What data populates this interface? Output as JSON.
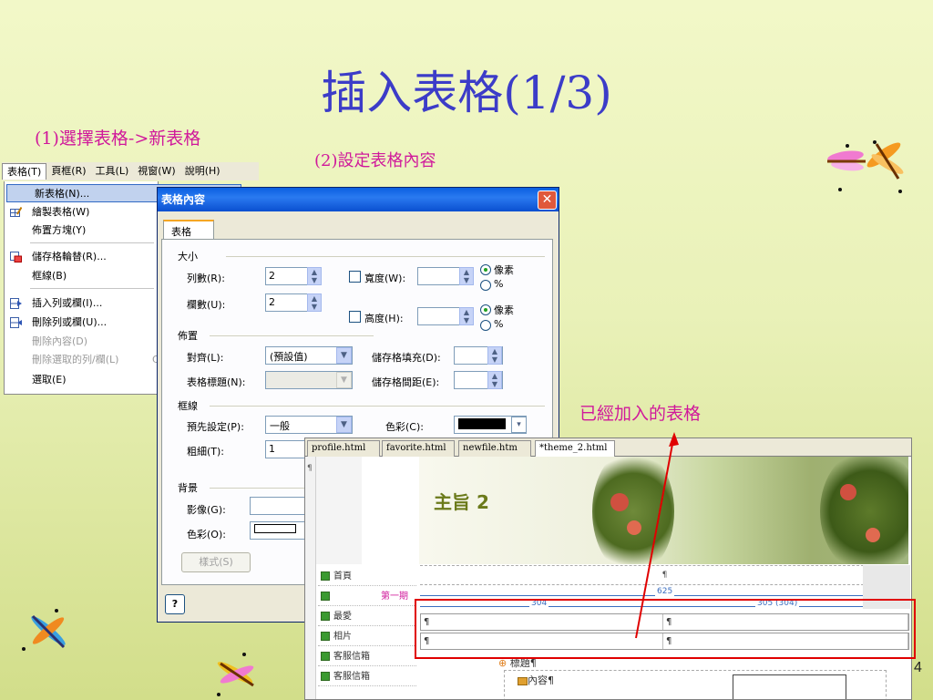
{
  "slide": {
    "title": "插入表格(1/3)",
    "step1": "(1)選擇表格->新表格",
    "step2": "(2)設定表格內容",
    "callout": "已經加入的表格",
    "page_number": "4"
  },
  "menubar": {
    "items": [
      "表格(T)",
      "頁框(R)",
      "工具(L)",
      "視窗(W)",
      "說明(H)"
    ]
  },
  "table_menu": {
    "items": [
      {
        "label": "新表格(N)...",
        "icon": "new-table-icon",
        "selected": true,
        "disabled": false
      },
      {
        "label": "繪製表格(W)",
        "icon": "draw-table-icon",
        "selected": false,
        "disabled": false
      },
      {
        "label": "佈置方塊(Y)",
        "icon": "",
        "selected": false,
        "disabled": false
      },
      {
        "label": "儲存格輪替(R)...",
        "icon": "cell-rotate-icon",
        "selected": false,
        "disabled": false
      },
      {
        "label": "框線(B)",
        "icon": "",
        "selected": false,
        "disabled": false
      },
      {
        "label": "插入列或欄(I)...",
        "icon": "insert-row-icon",
        "selected": false,
        "disabled": false
      },
      {
        "label": "刪除列或欄(U)...",
        "icon": "delete-row-icon",
        "selected": false,
        "disabled": false
      },
      {
        "label": "刪除內容(D)",
        "icon": "",
        "selected": false,
        "disabled": true
      },
      {
        "label": "刪除選取的列/欄(L)",
        "icon": "",
        "selected": false,
        "disabled": true
      },
      {
        "label": "選取(E)",
        "icon": "",
        "selected": false,
        "disabled": false
      }
    ],
    "trailing_glyph": "C"
  },
  "dialog": {
    "title": "表格內容",
    "tab": "表格",
    "size_group": "大小",
    "rows_label": "列數(R):",
    "rows_value": "2",
    "cols_label": "欄數(U):",
    "cols_value": "2",
    "width_label": "寬度(W):",
    "height_label": "高度(H):",
    "unit_pixel": "像素",
    "unit_percent": "%",
    "layout_group": "佈置",
    "align_label": "對齊(L):",
    "align_value": "(預設值)",
    "caption_label": "表格標題(N):",
    "padding_label": "儲存格填充(D):",
    "spacing_label": "儲存格間距(E):",
    "border_group": "框線",
    "preset_label": "預先設定(P):",
    "preset_value": "一般",
    "color_label": "色彩(C):",
    "thickness_label": "粗細(T):",
    "thickness_value": "1",
    "background_group": "背景",
    "image_label": "影像(G):",
    "bgcolor_label": "色彩(O):",
    "style_button": "樣式(S)",
    "help_button": "?"
  },
  "editor": {
    "tabs": [
      "profile.html",
      "favorite.html",
      "newfile.htm",
      "*theme_2.html"
    ],
    "banner_title": "主旨 2",
    "sidebar": [
      "首頁",
      "第一期",
      "最愛",
      "相片",
      "客服信箱",
      "客服信箱"
    ],
    "pilcrow": "¶",
    "table_width": "625",
    "col1_width": "304",
    "col2_width": "305 (304)",
    "heading_text": "標題¶",
    "content_text": "內容¶"
  },
  "colors": {
    "title": "#3c3cc8",
    "step_text": "#d0199b",
    "highlight": "#e00000",
    "xp_title": "#0a5fe0"
  }
}
